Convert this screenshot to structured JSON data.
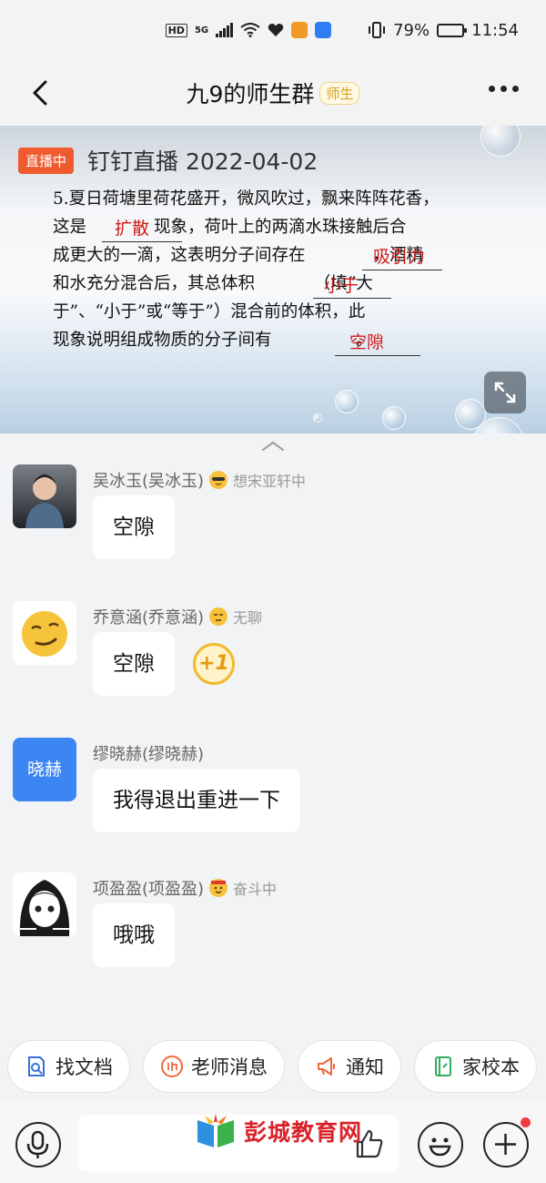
{
  "status_bar": {
    "hd": "HD",
    "signal": "5G",
    "battery": "79%",
    "time": "11:54"
  },
  "header": {
    "title": "九9的师生群",
    "badge": "师生"
  },
  "live": {
    "badge": "直播中",
    "title": "钉钉直播 2022-04-02",
    "question_lines": [
      "5.夏日荷塘里荷花盛开，微风吹过，飘来阵阵花香，",
      "这是　　　　现象，荷叶上的两滴水珠接触后合",
      "成更大的一滴，这表明分子间存在　　　　，酒精",
      "和水充分混合后，其总体积　　　　（填“大",
      "于”、“小于”或“等于”）混合前的体积，此",
      "现象说明组成物质的分子间有　　　　　。"
    ],
    "answers": [
      "扩散",
      "吸引力",
      "小于",
      "空隙"
    ]
  },
  "messages": [
    {
      "sender": "吴冰玉(吴冰玉)",
      "status": "想宋亚轩中",
      "text": "空隙"
    },
    {
      "sender": "乔意涵(乔意涵)",
      "status": "无聊",
      "text": "空隙",
      "reaction": "+1"
    },
    {
      "sender": "缪晓赫(缪晓赫)",
      "status": "",
      "text": "我得退出重进一下",
      "avatar_text": "晓赫"
    },
    {
      "sender": "项盈盈(项盈盈)",
      "status": "奋斗中",
      "text": "哦哦"
    }
  ],
  "quick_actions": [
    "找文档",
    "老师消息",
    "通知",
    "家校本"
  ],
  "watermark": "彭城教育网",
  "colors": {
    "accent_blue": "#3b86f2",
    "live_orange": "#ef5a2f",
    "answer_red": "#d01a1a",
    "badge_gold": "#d9a320"
  }
}
